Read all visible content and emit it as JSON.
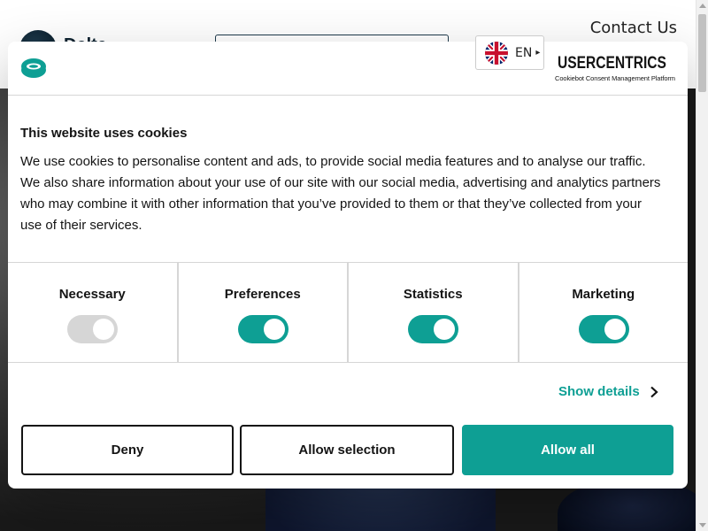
{
  "site": {
    "logo_text": "Delta",
    "contact_label": "Contact Us",
    "language": {
      "code": "EN",
      "flag": "uk-flag"
    }
  },
  "cookie_dialog": {
    "brand": {
      "name": "USERCENTRICS",
      "subtitle": "Cookiebot Consent Management Platform"
    },
    "title": "This website uses cookies",
    "body": "We use cookies to personalise content and ads, to provide social media features and to analyse our traffic. We also share information about your use of our site with our social media, advertising and analytics partners who may combine it with other information that you’ve provided to them or that they’ve collected from your use of their services.",
    "categories": [
      {
        "label": "Necessary",
        "enabled": true,
        "locked": true
      },
      {
        "label": "Preferences",
        "enabled": true,
        "locked": false
      },
      {
        "label": "Statistics",
        "enabled": true,
        "locked": false
      },
      {
        "label": "Marketing",
        "enabled": true,
        "locked": false
      }
    ],
    "show_details_label": "Show details",
    "buttons": {
      "deny": "Deny",
      "allow_selection": "Allow selection",
      "allow_all": "Allow all"
    },
    "accent_color": "#0e9f94"
  }
}
